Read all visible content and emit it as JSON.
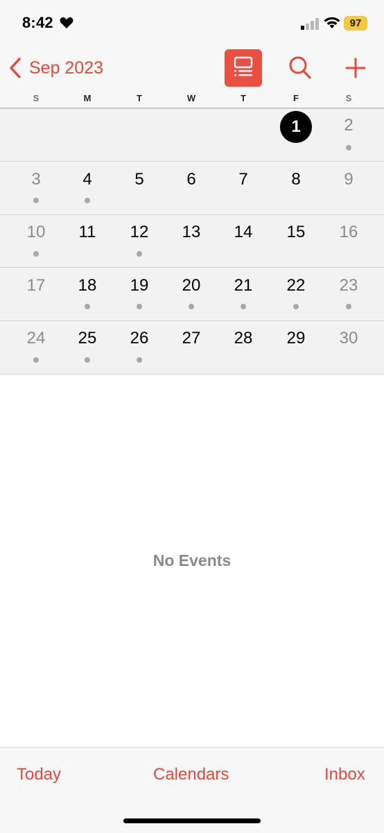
{
  "status_bar": {
    "time": "8:42",
    "battery": "97",
    "battery_color": "#f4c93b",
    "icons": [
      "heart-icon",
      "cellular-signal-icon",
      "wifi-icon",
      "battery-icon"
    ]
  },
  "nav": {
    "back_label": "Sep 2023",
    "accent_color": "#e5493a",
    "buttons": [
      "list-view-icon",
      "search-icon",
      "add-icon"
    ]
  },
  "weekdays": [
    "S",
    "M",
    "T",
    "W",
    "T",
    "F",
    "S"
  ],
  "calendar": {
    "selected_day": "1",
    "weeks": [
      [
        null,
        null,
        null,
        null,
        null,
        {
          "d": "1",
          "sel": true
        },
        {
          "d": "2",
          "muted": true,
          "dot": true
        }
      ],
      [
        {
          "d": "3",
          "muted": true,
          "dot": true
        },
        {
          "d": "4",
          "dot": true
        },
        {
          "d": "5"
        },
        {
          "d": "6"
        },
        {
          "d": "7"
        },
        {
          "d": "8"
        },
        {
          "d": "9",
          "muted": true
        }
      ],
      [
        {
          "d": "10",
          "muted": true,
          "dot": true
        },
        {
          "d": "11"
        },
        {
          "d": "12",
          "dot": true
        },
        {
          "d": "13"
        },
        {
          "d": "14"
        },
        {
          "d": "15"
        },
        {
          "d": "16",
          "muted": true
        }
      ],
      [
        {
          "d": "17",
          "muted": true
        },
        {
          "d": "18",
          "dot": true
        },
        {
          "d": "19",
          "dot": true
        },
        {
          "d": "20",
          "dot": true
        },
        {
          "d": "21",
          "dot": true
        },
        {
          "d": "22",
          "dot": true
        },
        {
          "d": "23",
          "muted": true,
          "dot": true
        }
      ],
      [
        {
          "d": "24",
          "muted": true,
          "dot": true
        },
        {
          "d": "25",
          "dot": true
        },
        {
          "d": "26",
          "dot": true
        },
        {
          "d": "27"
        },
        {
          "d": "28"
        },
        {
          "d": "29"
        },
        {
          "d": "30",
          "muted": true
        }
      ]
    ]
  },
  "events": {
    "empty_text": "No Events"
  },
  "tabbar": {
    "today": "Today",
    "calendars": "Calendars",
    "inbox": "Inbox"
  }
}
